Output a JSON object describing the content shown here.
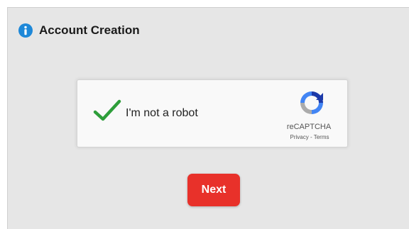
{
  "header": {
    "title": "Account Creation",
    "icon": "info-icon",
    "icon_color": "#1e88d8"
  },
  "captcha": {
    "checked": true,
    "checkmark_color": "#2e9e3a",
    "label": "I'm not a robot",
    "logo_icon": "recaptcha-logo-icon",
    "brand": "reCAPTCHA",
    "privacy_link": "Privacy",
    "separator": " - ",
    "terms_link": "Terms"
  },
  "actions": {
    "next_label": "Next",
    "next_color": "#e8312a"
  }
}
